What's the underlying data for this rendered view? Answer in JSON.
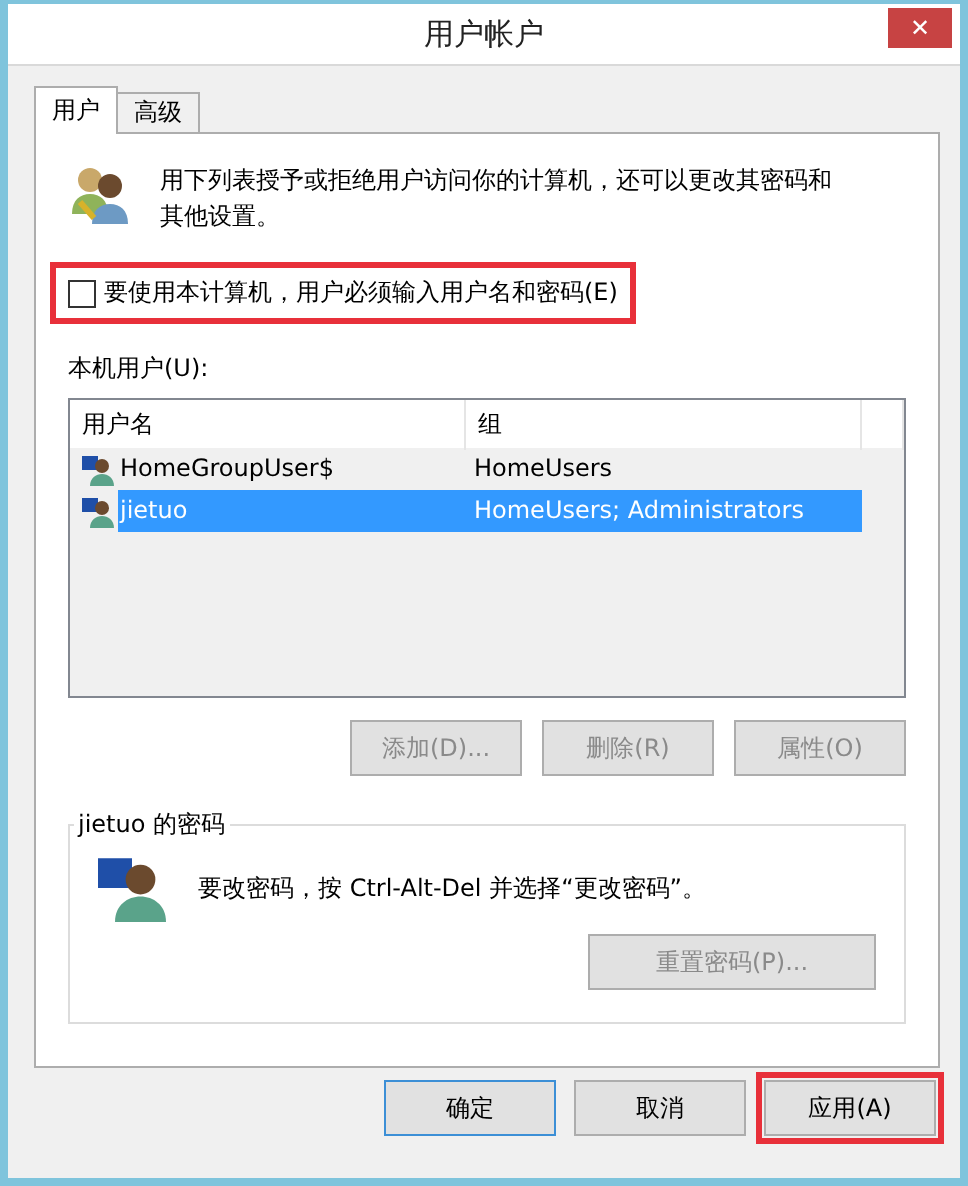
{
  "window": {
    "title": "用户帐户",
    "close": "✕"
  },
  "tabs": [
    {
      "label": "用户",
      "selected": true
    },
    {
      "label": "高级",
      "selected": false
    }
  ],
  "description": "用下列表授予或拒绝用户访问你的计算机，还可以更改其密码和其他设置。",
  "require_login": {
    "label": "要使用本计算机，用户必须输入用户名和密码(E)",
    "checked": false,
    "highlighted": true
  },
  "users_label": "本机用户(U):",
  "table": {
    "columns": [
      "用户名",
      "组"
    ],
    "rows": [
      {
        "name": "HomeGroupUser$",
        "group": "HomeUsers",
        "selected": false
      },
      {
        "name": "jietuo",
        "group": "HomeUsers; Administrators",
        "selected": true
      }
    ]
  },
  "list_buttons": [
    {
      "label": "添加(D)...",
      "disabled": true
    },
    {
      "label": "删除(R)",
      "disabled": true
    },
    {
      "label": "属性(O)",
      "disabled": true
    }
  ],
  "password_group": {
    "title": "jietuo 的密码",
    "text": "要改密码，按 Ctrl-Alt-Del 并选择“更改密码”。",
    "button": {
      "label": "重置密码(P)...",
      "disabled": true
    }
  },
  "dialog_buttons": [
    {
      "label": "确定",
      "default": true,
      "highlighted": false
    },
    {
      "label": "取消",
      "default": false,
      "highlighted": false
    },
    {
      "label": "应用(A)",
      "default": false,
      "highlighted": true
    }
  ]
}
